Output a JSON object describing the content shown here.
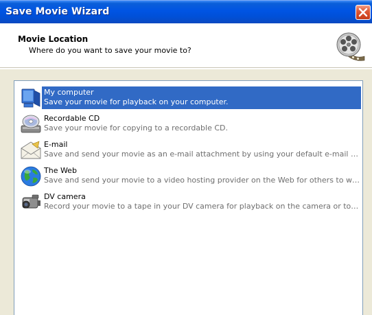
{
  "window": {
    "title": "Save Movie Wizard"
  },
  "header": {
    "title": "Movie Location",
    "subtitle": "Where do you want to save your movie to?",
    "icon": "film-reel-icon"
  },
  "options": [
    {
      "name": "My computer",
      "description": "Save your movie for playback on your computer.",
      "icon": "computer-icon",
      "selected": true
    },
    {
      "name": "Recordable CD",
      "description": "Save your movie for copying to a recordable CD.",
      "icon": "cd-icon",
      "selected": false
    },
    {
      "name": "E-mail",
      "description": "Save and send your movie as an e-mail attachment by using your default e-mail program.",
      "icon": "email-icon",
      "selected": false
    },
    {
      "name": "The Web",
      "description": "Save and send your movie to a video hosting provider on the Web for others to watch.",
      "icon": "globe-icon",
      "selected": false
    },
    {
      "name": "DV camera",
      "description": "Record your movie to a tape in your DV camera for playback on the camera or to watch o...",
      "icon": "camcorder-icon",
      "selected": false
    }
  ],
  "colors": {
    "title_bar": "#0054e3",
    "selection": "#316ac5",
    "dialog_background": "#ece9d8",
    "close_button": "#d54a26"
  }
}
